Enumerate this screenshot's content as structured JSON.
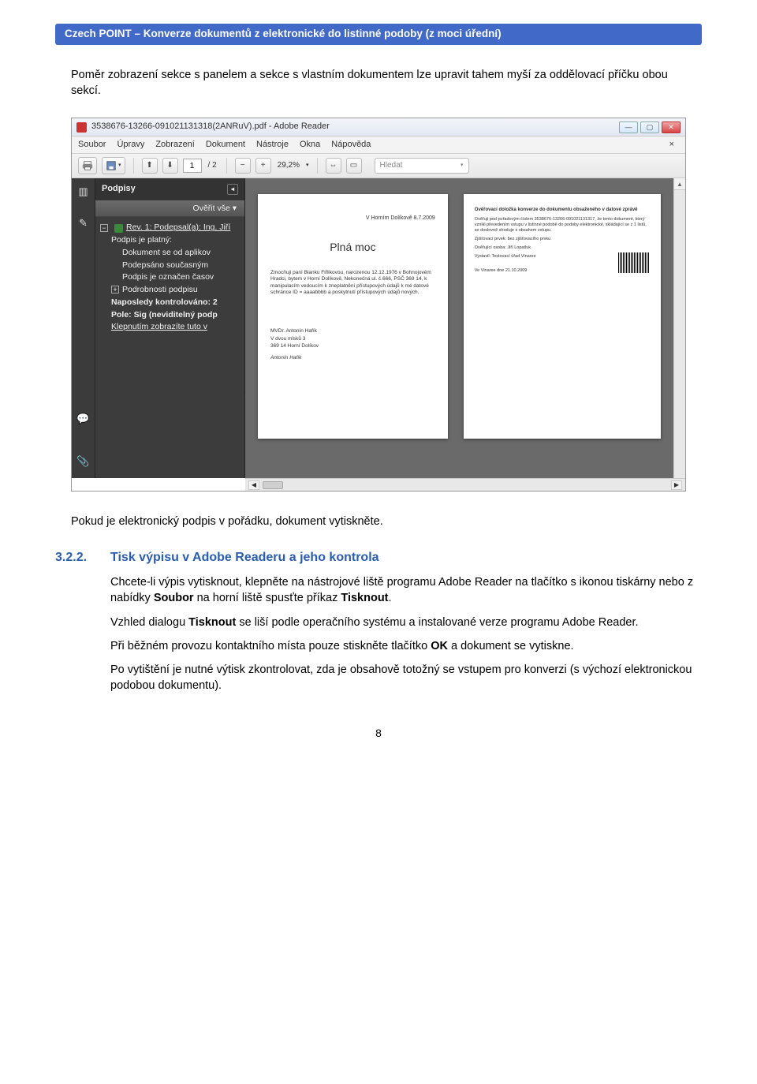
{
  "header": {
    "title": "Czech POINT – Konverze dokumentů z elektronické do listinné podoby (z moci úřední)"
  },
  "intro": {
    "p1": "Poměr zobrazení sekce s panelem a sekce s vlastním dokumentem lze upravit tahem myší za oddělovací příčku obou sekcí."
  },
  "reader": {
    "title": "3538676-13266-091021131318(2ANRuV).pdf - Adobe Reader",
    "menu": [
      "Soubor",
      "Úpravy",
      "Zobrazení",
      "Dokument",
      "Nástroje",
      "Okna",
      "Nápověda"
    ],
    "page_current": "1",
    "page_total": "/ 2",
    "zoom": "29,2%",
    "search_placeholder": "Hledat",
    "sigpanel": {
      "title": "Podpisy",
      "verify": "Ověřit vše",
      "lines": [
        "Rev. 1: Podepsal(a): Ing. Jiří",
        "Podpis je platný:",
        "Dokument se od aplikov",
        "Podepsáno současným",
        "Podpis je označen časov",
        "Podrobnosti podpisu",
        "Naposledy kontrolováno: 2",
        "Pole: Sig (neviditelný podp",
        "Klepnutím zobrazíte tuto v"
      ]
    },
    "doc_a": {
      "date": "V Horním Dolíkově 8.7.2009",
      "title": "Plná moc",
      "para": "Zmocňuji paní Blanku Fiflíkovou, narozenou 12.12.1976 v Bohnojovém Hradci, bytem v Horní Dolíkově, Nekonečná ul. č.666, PSČ 369 14, k manipulacím vedoucím k zneplatnění přístupových údajů k mé datové schránce ID = aaaabbbb a poskytnutí přístupových údajů nových.",
      "sig1": "MVDr. Antonín Hafík",
      "sig2": "V dvou mlsků 3",
      "sig3": "369 14  Horní Dolíkov",
      "sigscript": "Antonín Hafík"
    },
    "doc_b": {
      "head": "Ověřovací doložka konverze do dokumentu obsaženého v datové zprávě",
      "l1": "Ověřuji pod pořadovým číslem 3538676-13266-091021131317, že tento dokument, který vznikl převedením vstupu v listinné podobě do podoby elektronické, skládající se z 1 listů, se doslovně shoduje s obsahem vstupu.",
      "l2": "Zjišťovací prvek: bez zjišťovacího prvku",
      "l3": "Ověřující osoba: Jiří Lopatluk",
      "l4": "Vystavil: Testovací úřad Vinaree",
      "l5": "Ve Vinaree dne 21.10.2009"
    }
  },
  "after_sshot": {
    "p1": "Pokud je elektronický podpis v pořádku, dokument vytiskněte."
  },
  "section": {
    "num": "3.2.2.",
    "title": "Tisk výpisu v Adobe Readeru a jeho kontrola",
    "p1a": "Chcete-li výpis vytisknout, klepněte na nástrojové liště programu Adobe Reader na tlačítko s ikonou tiskárny nebo z nabídky ",
    "p1b": "Soubor",
    "p1c": " na horní liště spusťte příkaz ",
    "p1d": "Tisknout",
    "p1e": ".",
    "p2a": "Vzhled dialogu ",
    "p2b": "Tisknout",
    "p2c": " se liší podle operačního systému a instalované verze programu Adobe Reader.",
    "p3a": "Při běžném provozu kontaktního místa pouze stiskněte tlačítko ",
    "p3b": "OK",
    "p3c": " a dokument se vytiskne.",
    "p4": "Po vytištění je nutné výtisk zkontrolovat, zda je obsahově totožný se vstupem pro konverzi (s výchozí elektronickou podobou dokumentu)."
  },
  "pagenum": "8"
}
